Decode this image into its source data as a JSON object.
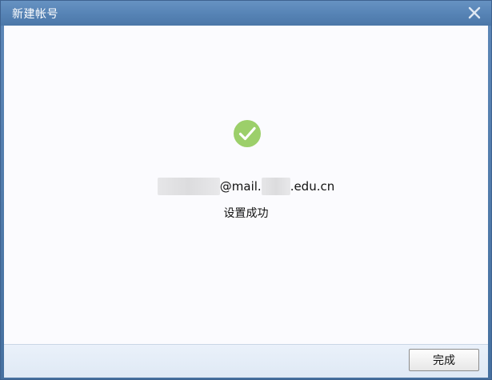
{
  "window": {
    "title": "新建帐号",
    "close_icon": "close-icon"
  },
  "content": {
    "success_icon": "check-circle-icon",
    "email_visible_part_1": "@mail.",
    "email_visible_part_2": ".edu.cn",
    "status": "设置成功"
  },
  "footer": {
    "done_label": "完成"
  },
  "colors": {
    "titlebar": "#5784b6",
    "success": "#9ccf6a",
    "content_bg": "#fbfbfe",
    "footer_bg": "#e4edf8"
  }
}
